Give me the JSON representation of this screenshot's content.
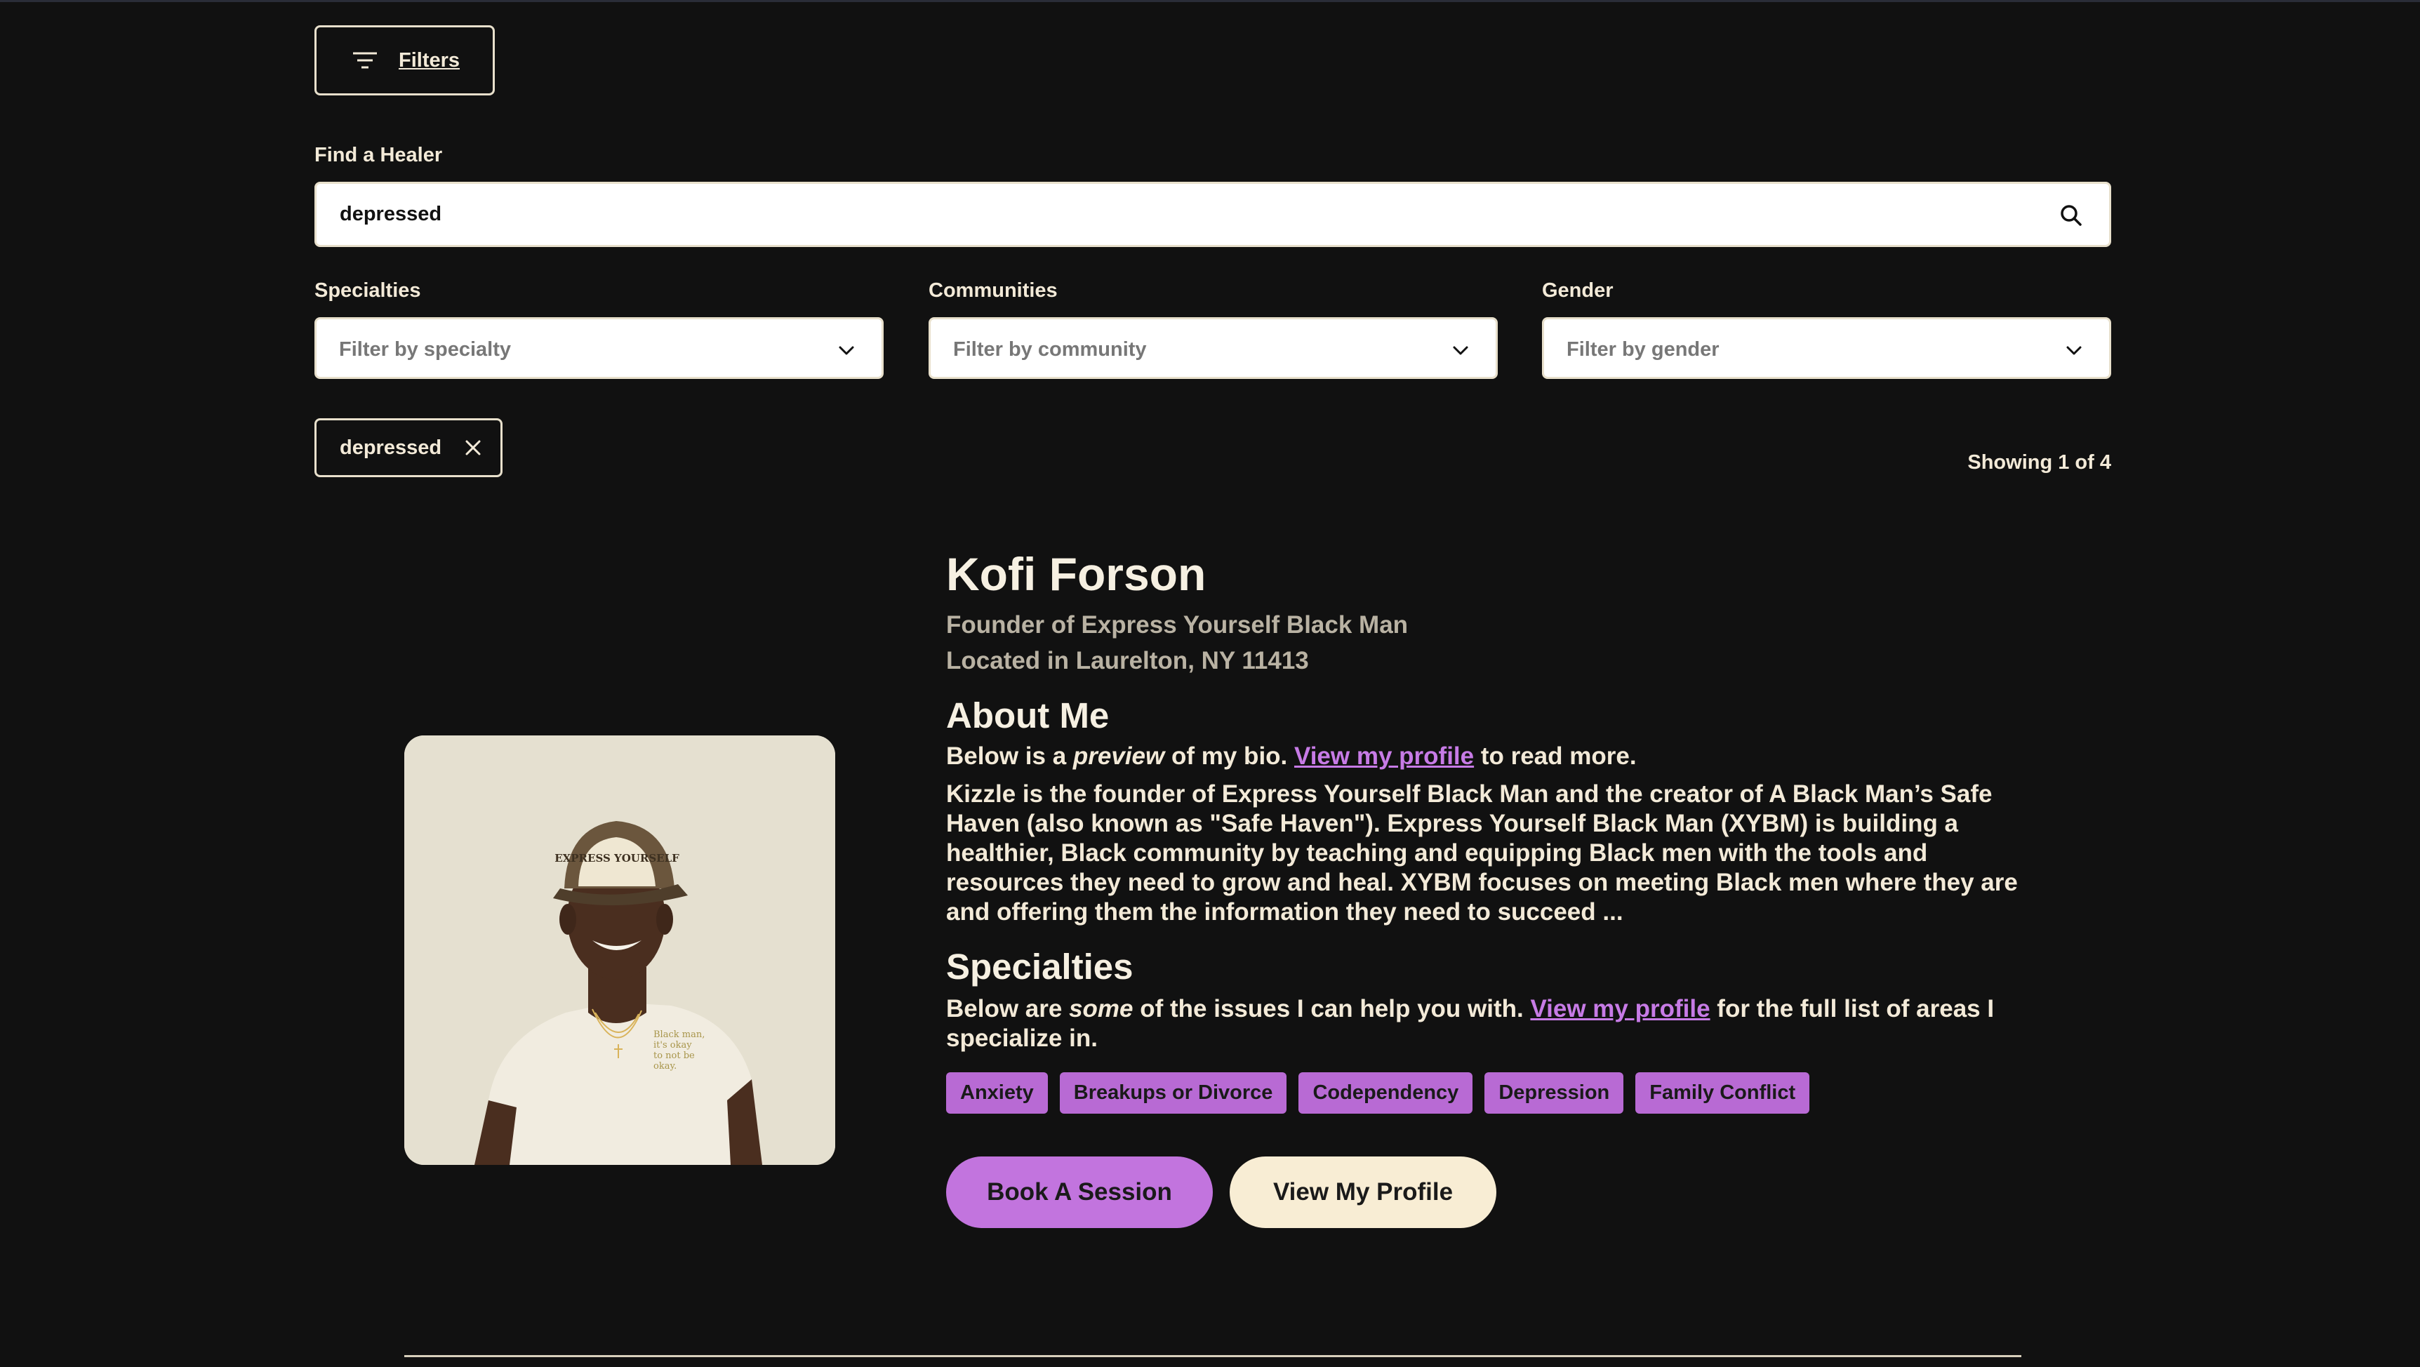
{
  "filters_button": {
    "label": "Filters",
    "icon": "filter-lines-icon"
  },
  "search": {
    "label": "Find a Healer",
    "value": "depressed",
    "placeholder": "",
    "icon": "search-icon"
  },
  "dropdowns": [
    {
      "label": "Specialties",
      "placeholder": "Filter by specialty"
    },
    {
      "label": "Communities",
      "placeholder": "Filter by community"
    },
    {
      "label": "Gender",
      "placeholder": "Filter by gender"
    }
  ],
  "active_chip": {
    "label": "depressed"
  },
  "results": {
    "showing": "Showing 1 of 4"
  },
  "profile": {
    "name": "Kofi Forson",
    "title": "Founder of Express Yourself Black Man",
    "location": "Located in Laurelton, NY 11413",
    "about_heading": "About Me",
    "about_intro_pre": "Below is a ",
    "about_intro_em": "preview",
    "about_intro_mid": " of my bio. ",
    "about_intro_link": "View my profile",
    "about_intro_post": " to read more.",
    "bio": "Kizzle is the founder of Express Yourself Black Man and the creator of A Black Man’s Safe Haven (also known as \"Safe Haven\"). Express Yourself Black Man (XYBM) is building a healthier, Black community by teaching and equipping Black men with the tools and resources they need to grow and heal. XYBM focuses on meeting Black men where they are and offering them the information they need to succeed ...",
    "specialties_heading": "Specialties",
    "spec_intro_pre": "Below are ",
    "spec_intro_em": "some",
    "spec_intro_mid": " of the issues I can help you with. ",
    "spec_intro_link": "View my profile",
    "spec_intro_post": " for the full list of areas I specialize in.",
    "tags": [
      "Anxiety",
      "Breakups or Divorce",
      "Codependency",
      "Depression",
      "Family Conflict"
    ],
    "book_label": "Book A Session",
    "view_label": "View My Profile",
    "hat_text": "EXPRESS YOURSELF",
    "shirt_text": "Black man, it's okay to not be okay."
  },
  "colors": {
    "background": "#111111",
    "accent": "#c274de",
    "cream": "#f8edd4"
  }
}
